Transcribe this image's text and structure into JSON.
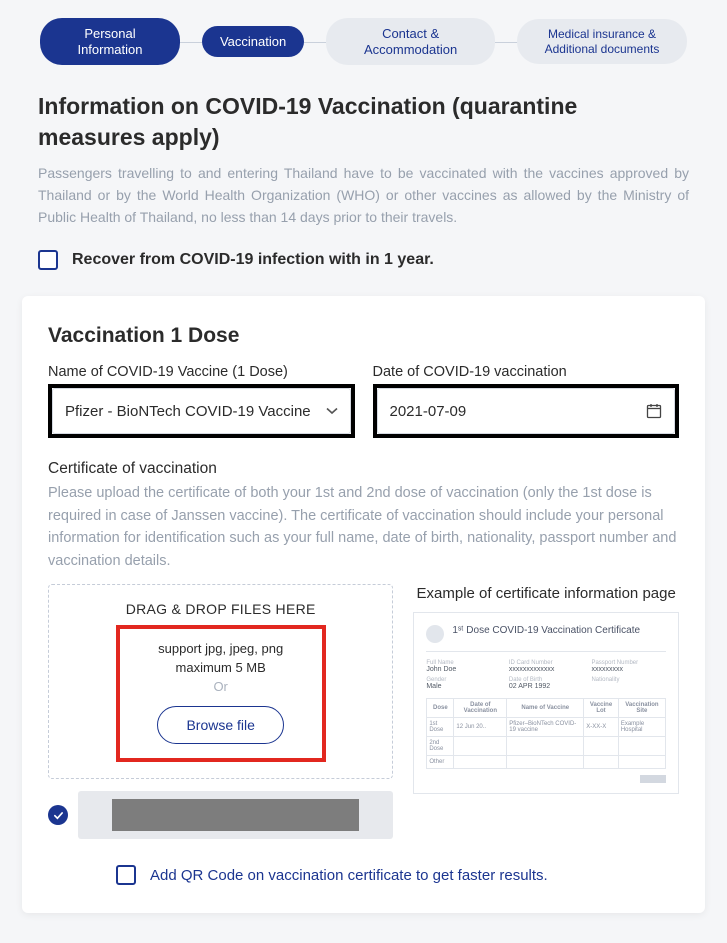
{
  "steps": {
    "s1": "Personal Information",
    "s2": "Vaccination",
    "s3": "Contact & Accommodation",
    "s4": "Medical insurance & Additional documents"
  },
  "intro": {
    "title": "Information on COVID-19 Vaccination (quarantine measures apply)",
    "body": "Passengers travelling to and entering Thailand have to be vaccinated with the vaccines approved by Thailand or by the World Health Organization (WHO) or other vaccines as allowed by the Ministry of Public Health of Thailand, no less than 14 days prior to their travels."
  },
  "recover_label": "Recover from COVID-19 infection with in 1 year.",
  "dose": {
    "heading": "Vaccination 1 Dose",
    "name_label": "Name of COVID-19 Vaccine (1 Dose)",
    "name_value": "Pfizer - BioNTech COVID-19 Vaccine",
    "date_label": "Date of COVID-19 vaccination",
    "date_value": "2021-07-09"
  },
  "cert": {
    "label": "Certificate of vaccination",
    "desc": "Please upload the certificate of both your 1st and 2nd dose of vaccination (only the 1st dose is required in case of Janssen vaccine). The certificate of vaccination should include your personal information for identification such as your full name, date of birth, nationality, passport number and vaccination details.",
    "drop_title": "DRAG & DROP FILES HERE",
    "support": "support jpg, jpeg, png",
    "maxsize": "maximum 5 MB",
    "or": "Or",
    "browse": "Browse file",
    "example_title": "Example of certificate information page",
    "example_heading": "1ˢᵗ Dose COVID-19 Vaccination Certificate"
  },
  "qr_label": "Add QR Code on vaccination certificate to get faster results."
}
